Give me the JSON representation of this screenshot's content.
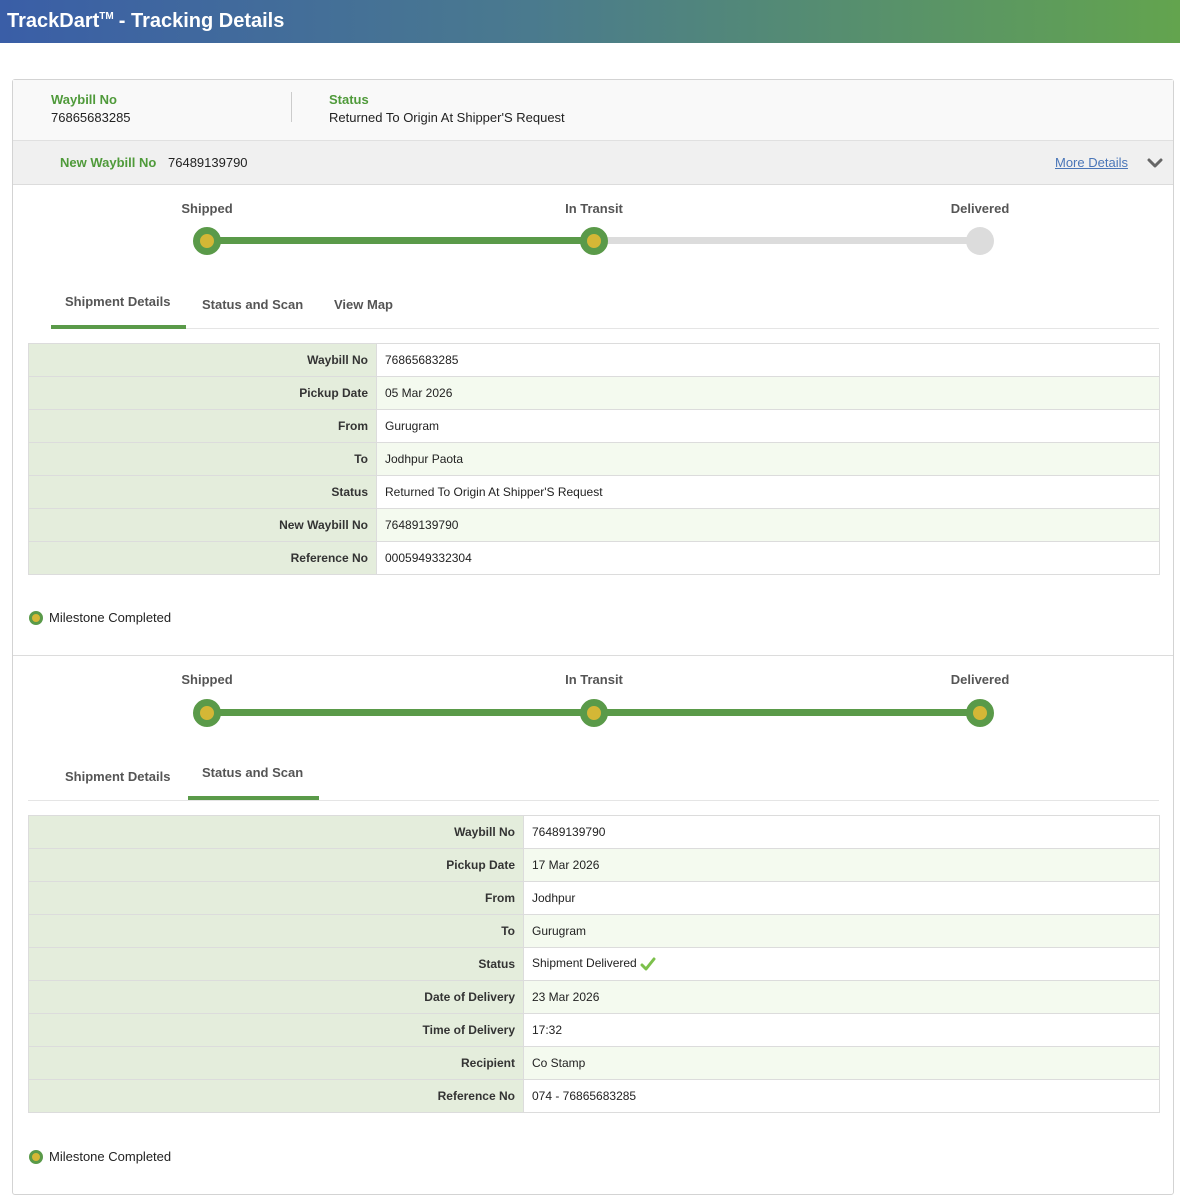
{
  "app": {
    "title_brand": "TrackDart",
    "title_tm": "TM",
    "title_rest": "- Tracking Details"
  },
  "summary": {
    "waybill_label": "Waybill No",
    "waybill_value": "76865683285",
    "status_label": "Status",
    "status_value": "Returned To Origin At Shipper'S Request"
  },
  "new_waybill": {
    "label": "New Waybill No",
    "value": "76489139790",
    "more_details": "More Details",
    "chevron_icon": "chevron-down-icon"
  },
  "colors": {
    "accent_green": "#5a9a49",
    "label_green": "#4f9a3a",
    "dot_yellow": "#d4b736",
    "link_blue": "#4a76b8"
  },
  "shipments": [
    {
      "steps": [
        {
          "label": "Shipped",
          "done": true
        },
        {
          "label": "In Transit",
          "done": true
        },
        {
          "label": "Delivered",
          "done": false
        }
      ],
      "tabs": [
        "Shipment Details",
        "Status and Scan",
        "View Map"
      ],
      "active_tab": "Shipment Details",
      "rows": [
        {
          "key": "Waybill No",
          "value": "76865683285"
        },
        {
          "key": "Pickup Date",
          "value": "05 Mar 2026"
        },
        {
          "key": "From",
          "value": "Gurugram"
        },
        {
          "key": "To",
          "value": "Jodhpur Paota"
        },
        {
          "key": "Status",
          "value": "Returned To Origin At Shipper'S Request"
        },
        {
          "key": "New Waybill No",
          "value": "76489139790"
        },
        {
          "key": "Reference No",
          "value": "0005949332304"
        }
      ],
      "legend": "Milestone Completed"
    },
    {
      "steps": [
        {
          "label": "Shipped",
          "done": true
        },
        {
          "label": "In Transit",
          "done": true
        },
        {
          "label": "Delivered",
          "done": true
        }
      ],
      "tabs": [
        "Shipment Details",
        "Status and Scan"
      ],
      "active_tab": "Status and Scan",
      "rows": [
        {
          "key": "Waybill No",
          "value": "76489139790"
        },
        {
          "key": "Pickup Date",
          "value": "17 Mar 2026"
        },
        {
          "key": "From",
          "value": "Jodhpur"
        },
        {
          "key": "To",
          "value": "Gurugram"
        },
        {
          "key": "Status",
          "value": "Shipment Delivered",
          "icon": "checkmark-icon"
        },
        {
          "key": "Date of Delivery",
          "value": "23 Mar 2026"
        },
        {
          "key": "Time of Delivery",
          "value": "17:32"
        },
        {
          "key": "Recipient",
          "value": "Co Stamp"
        },
        {
          "key": "Reference No",
          "value": "074 - 76865683285"
        }
      ],
      "legend": "Milestone Completed"
    }
  ]
}
